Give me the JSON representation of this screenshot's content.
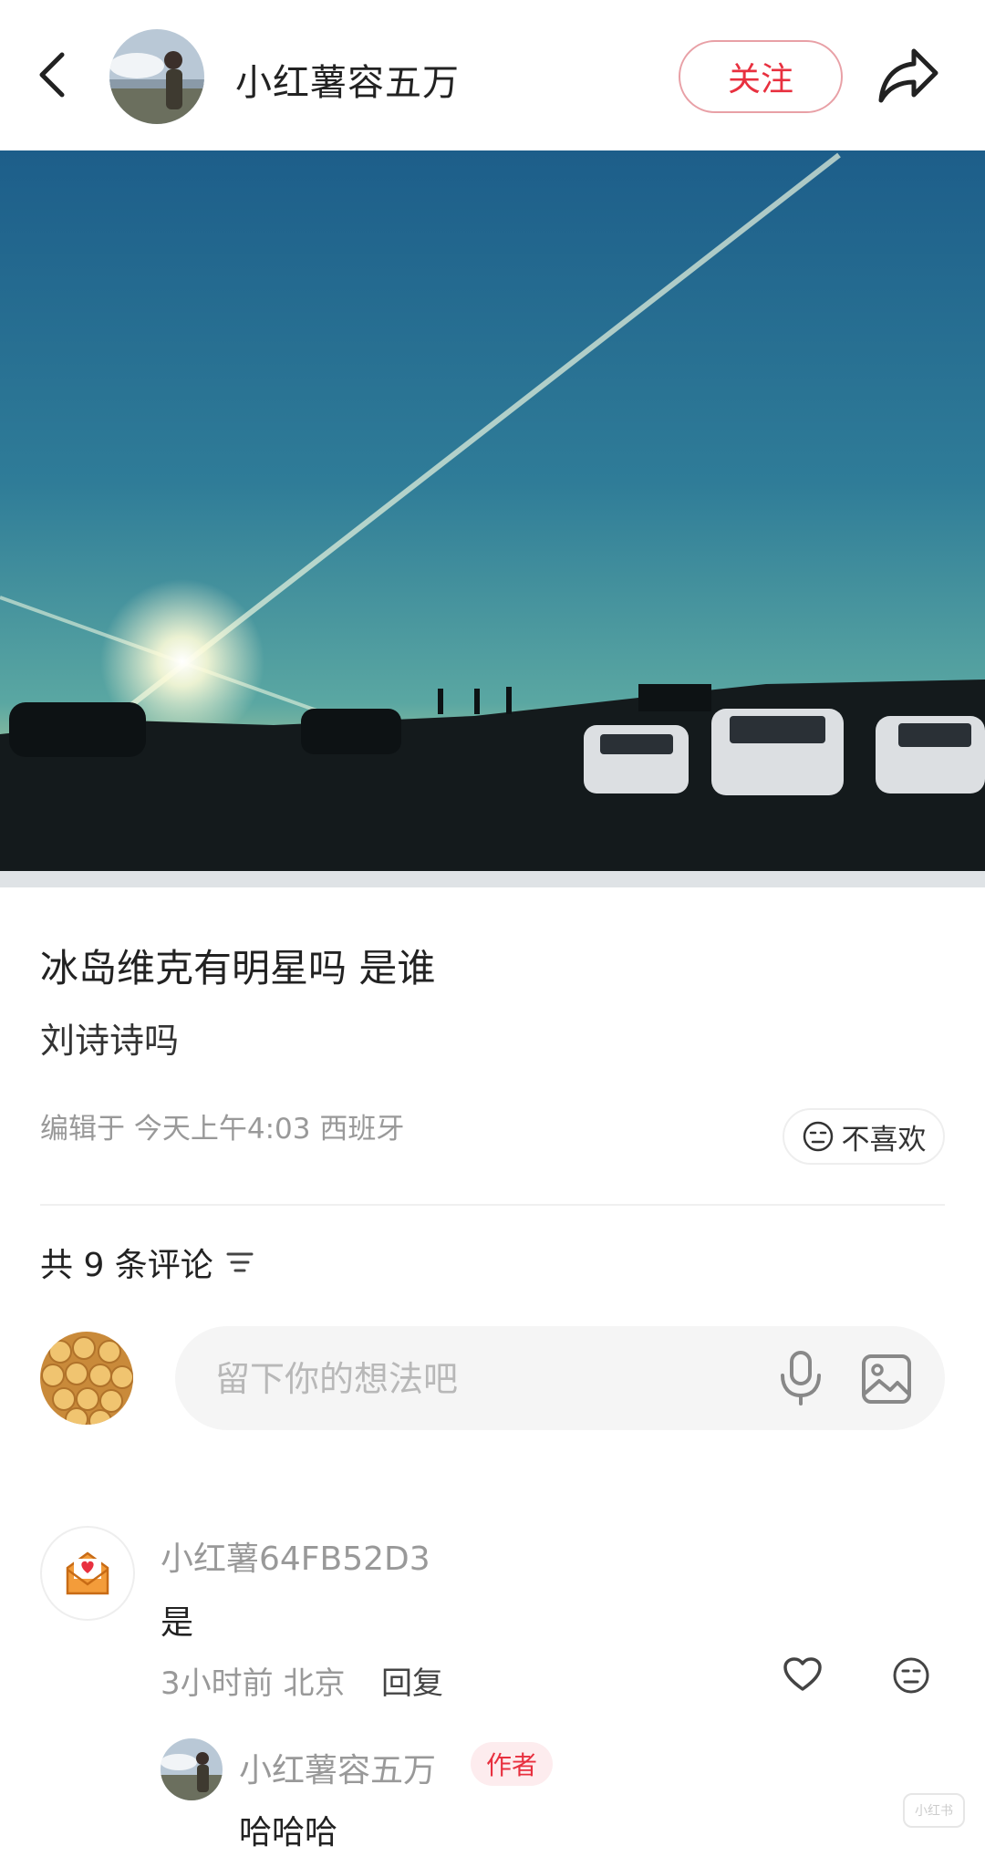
{
  "header": {
    "author_name": "小红薯容五万",
    "follow_label": "关注"
  },
  "post": {
    "title": "冰岛维克有明星吗 是谁",
    "body": "刘诗诗吗",
    "meta": "编辑于 今天上午4:03 西班牙",
    "dislike_label": "不喜欢"
  },
  "comments_header": {
    "count_label": "共 9 条评论"
  },
  "comment_input": {
    "placeholder": "留下你的想法吧"
  },
  "comments": [
    {
      "user": "小红薯64FB52D3",
      "text": "是",
      "time_location": "3小时前 北京",
      "reply_label": "回复",
      "replies": [
        {
          "user": "小红薯容五万",
          "badge": "作者",
          "text": "哈哈哈"
        }
      ]
    }
  ],
  "watermark": "小红书",
  "colors": {
    "accent": "#e8303f",
    "muted_text": "#999999",
    "input_bg": "#f5f5f5"
  },
  "icons": [
    "back-arrow-icon",
    "share-icon",
    "neutral-face-icon",
    "filter-lines-icon",
    "microphone-icon",
    "image-icon",
    "heart-icon",
    "letter-heart-icon"
  ]
}
